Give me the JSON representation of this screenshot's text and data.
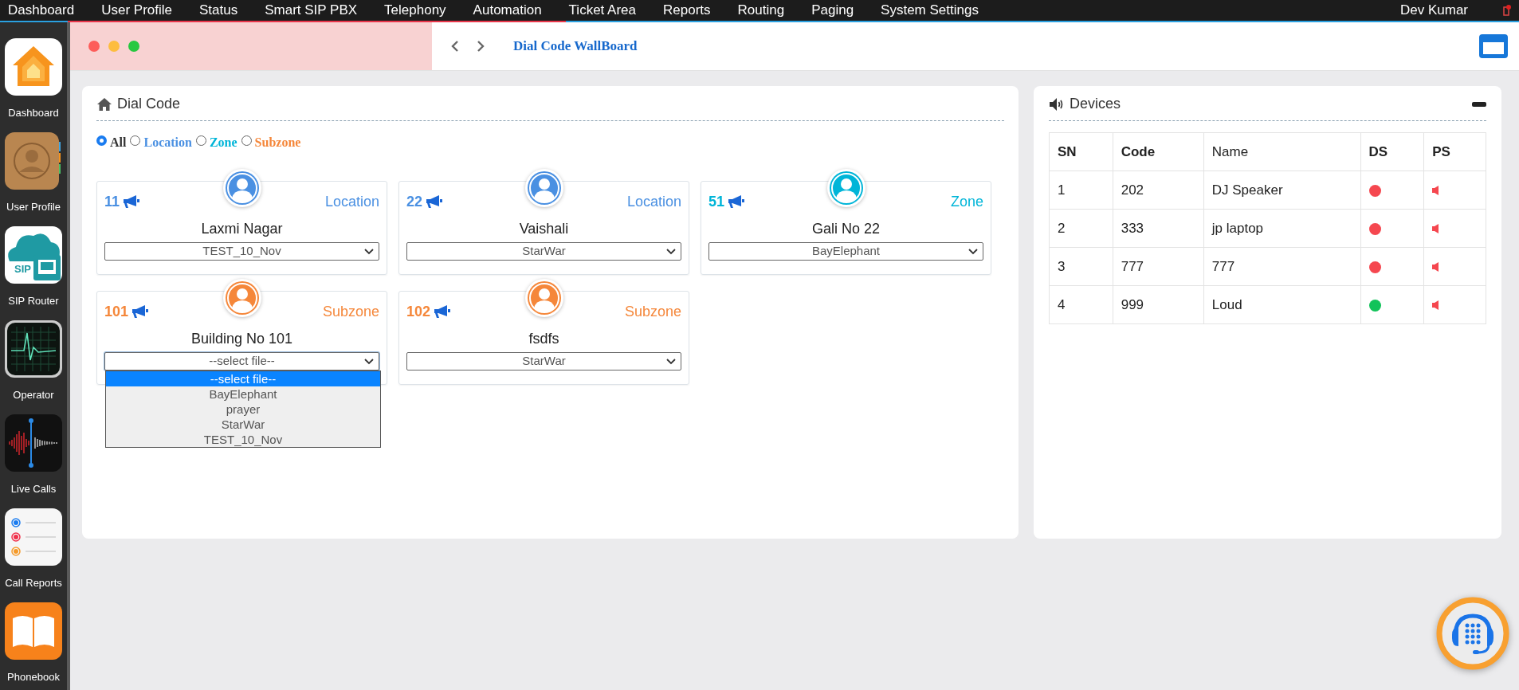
{
  "menu_bar": {
    "items": [
      "Dashboard",
      "User Profile",
      "Status",
      "Smart SIP PBX",
      "Telephony",
      "Automation",
      "Ticket Area",
      "Reports",
      "Routing",
      "Paging",
      "System Settings"
    ],
    "user": "Dev Kumar"
  },
  "sidebar": {
    "items": [
      {
        "label": "Dashboard",
        "kind": "home"
      },
      {
        "label": "User Profile",
        "kind": "contacts"
      },
      {
        "label": "SIP Router",
        "kind": "cloud",
        "icon_text": "SIP"
      },
      {
        "label": "Operator",
        "kind": "monitor"
      },
      {
        "label": "Live Calls",
        "kind": "waveform"
      },
      {
        "label": "Call Reports",
        "kind": "list"
      },
      {
        "label": "Phonebook",
        "kind": "book"
      }
    ]
  },
  "header": {
    "title": "Dial Code WallBoard"
  },
  "dial_code": {
    "title": "Dial Code",
    "filters": [
      {
        "label": "All",
        "selected": true,
        "color": "#333333"
      },
      {
        "label": "Location",
        "selected": false,
        "color": "#4a90e2"
      },
      {
        "label": "Zone",
        "selected": false,
        "color": "#00b5d8"
      },
      {
        "label": "Subzone",
        "selected": false,
        "color": "#f5873a"
      }
    ],
    "cards": [
      {
        "code": "11",
        "type": "Location",
        "name": "Laxmi Nagar",
        "color": "#4a90e2",
        "select": {
          "value": "TEST_10_Nov",
          "expanded": false
        }
      },
      {
        "code": "22",
        "type": "Location",
        "name": "Vaishali",
        "color": "#4a90e2",
        "select": {
          "value": "StarWar",
          "expanded": false
        }
      },
      {
        "code": "51",
        "type": "Zone",
        "name": "Gali No 22",
        "color": "#00b5d8",
        "select": {
          "value": "BayElephant",
          "expanded": false
        }
      },
      {
        "code": "101",
        "type": "Subzone",
        "name": "Building No 101",
        "color": "#f5873a",
        "select": {
          "value": "--select file--",
          "expanded": true,
          "options": [
            {
              "label": "--select file--",
              "selected": true
            },
            {
              "label": "BayElephant",
              "selected": false
            },
            {
              "label": "prayer",
              "selected": false
            },
            {
              "label": "StarWar",
              "selected": false
            },
            {
              "label": "TEST_10_Nov",
              "selected": false
            }
          ]
        }
      },
      {
        "code": "102",
        "type": "Subzone",
        "name": "fsdfs",
        "color": "#f5873a",
        "select": {
          "value": "StarWar",
          "expanded": false
        }
      }
    ]
  },
  "devices": {
    "title": "Devices",
    "table": {
      "columns": [
        {
          "label": "SN",
          "bold": true
        },
        {
          "label": "Code",
          "bold": true
        },
        {
          "label": "Name",
          "bold": false
        },
        {
          "label": "DS",
          "bold": true
        },
        {
          "label": "PS",
          "bold": true
        }
      ],
      "rows": [
        {
          "cells": [
            "1",
            "202",
            "DJ Speaker"
          ],
          "color": "#f5474f"
        },
        {
          "cells": [
            "2",
            "333",
            "jp laptop"
          ],
          "color": "#f5474f"
        },
        {
          "cells": [
            "3",
            "777",
            "777"
          ],
          "color": "#f5474f"
        },
        {
          "cells": [
            "4",
            "999",
            "Loud"
          ],
          "color": "#12c35a"
        }
      ]
    }
  }
}
